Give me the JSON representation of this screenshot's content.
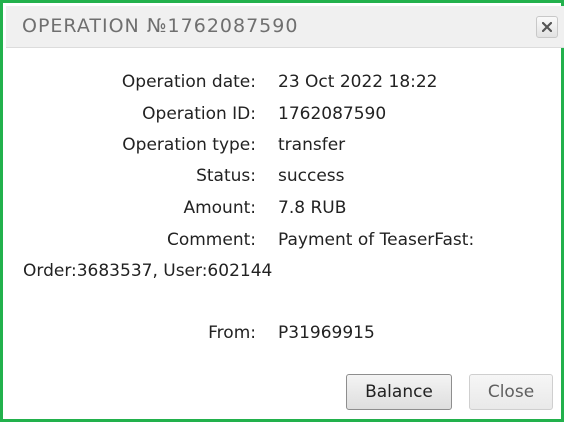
{
  "dialog": {
    "title": "OPERATION №1762087590",
    "close_icon": "close-icon"
  },
  "details": [
    {
      "label": "Operation date:",
      "value": "23 Oct 2022 18:22"
    },
    {
      "label": "Operation ID:",
      "value": "1762087590"
    },
    {
      "label": "Operation type:",
      "value": "transfer"
    },
    {
      "label": "Status:",
      "value": "success"
    },
    {
      "label": "Amount:",
      "value": "7.8 RUB"
    },
    {
      "label": "Comment:",
      "value": "Payment of TeaserFast:"
    }
  ],
  "comment_continued": "Order:3683537, User:602144",
  "from": {
    "label": "From:",
    "value": "P31969915"
  },
  "buttons": {
    "balance": "Balance",
    "close": "Close"
  },
  "colors": {
    "border": "#22b14c",
    "titlebar": "#f0f0f0"
  }
}
